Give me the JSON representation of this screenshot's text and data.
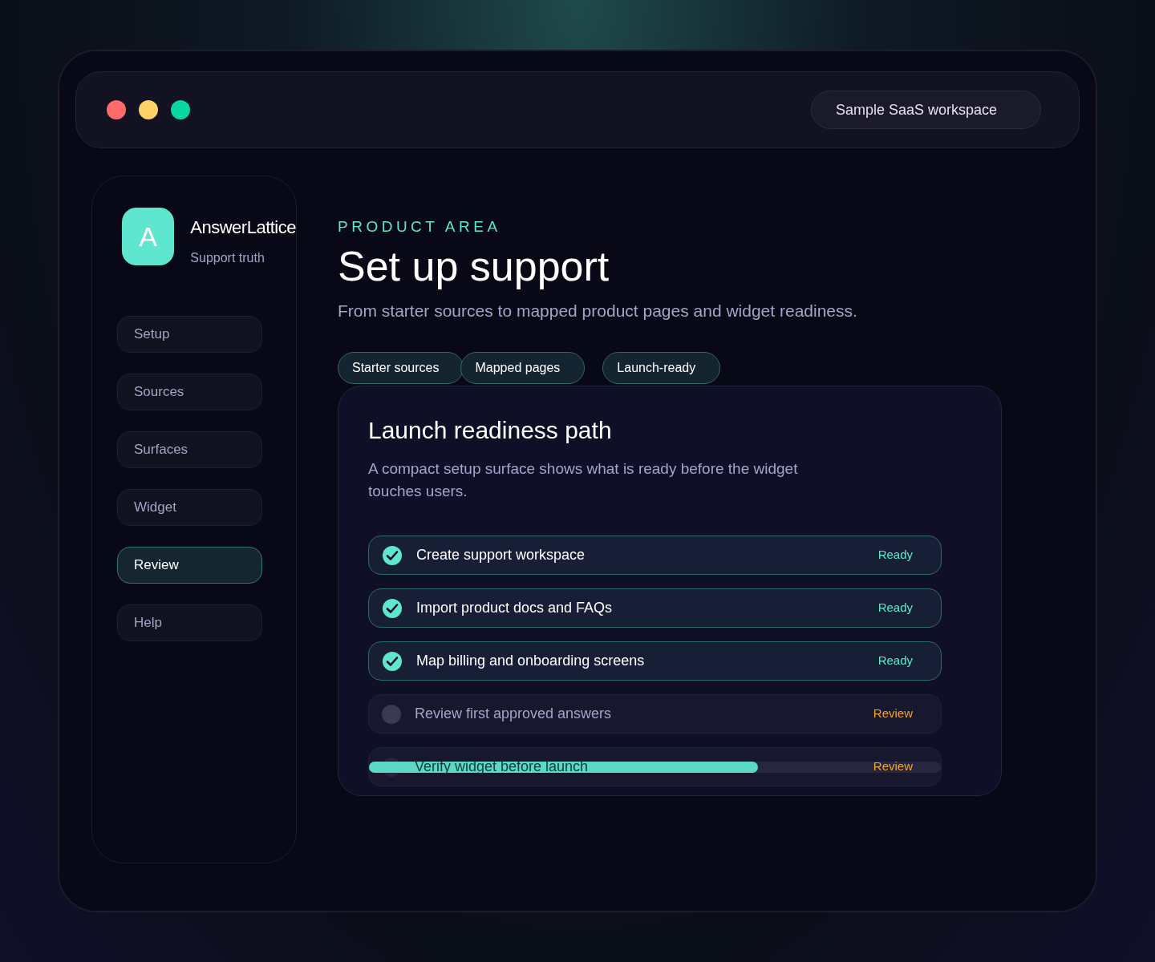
{
  "window": {
    "workspace": "Sample SaaS workspace"
  },
  "brand": {
    "initial": "A",
    "name": "AnswerLattice",
    "tagline": "Support truth"
  },
  "sidebar": {
    "items": [
      {
        "label": "Setup",
        "selected": false
      },
      {
        "label": "Sources",
        "selected": false
      },
      {
        "label": "Surfaces",
        "selected": false
      },
      {
        "label": "Widget",
        "selected": false
      },
      {
        "label": "Review",
        "selected": true
      },
      {
        "label": "Help",
        "selected": false
      }
    ]
  },
  "header": {
    "eyebrow": "PRODUCT AREA",
    "title": "Set up support",
    "subtitle": "From starter sources to mapped product pages and widget readiness."
  },
  "chips": [
    "Starter sources",
    "Mapped pages",
    "Launch-ready"
  ],
  "card": {
    "title": "Launch readiness path",
    "description": "A compact setup surface shows what is ready before the widget touches users.",
    "steps": [
      {
        "label": "Create support workspace",
        "status": "Ready",
        "done": true
      },
      {
        "label": "Import product docs and FAQs",
        "status": "Ready",
        "done": true
      },
      {
        "label": "Map billing and onboarding screens",
        "status": "Ready",
        "done": true
      },
      {
        "label": "Review first approved answers",
        "status": "Review",
        "done": false
      },
      {
        "label": "Verify widget before launch",
        "status": "Review",
        "done": false
      }
    ],
    "progress": {
      "level": 0.68
    }
  }
}
